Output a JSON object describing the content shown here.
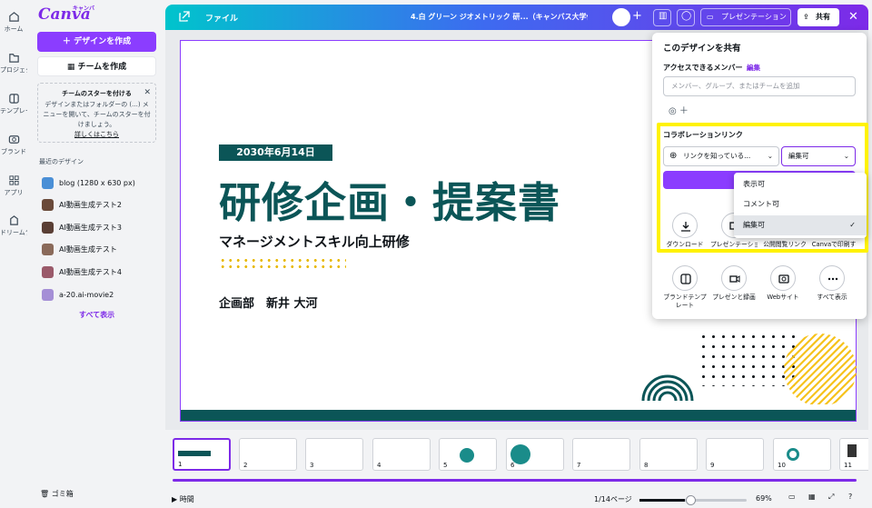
{
  "rail": {
    "items": [
      {
        "label": "ホーム",
        "icon": "home-icon"
      },
      {
        "label": "プロジェク...",
        "icon": "folder-icon"
      },
      {
        "label": "テンプレー...",
        "icon": "template-icon"
      },
      {
        "label": "ブランド",
        "icon": "brand-icon"
      },
      {
        "label": "アプリ",
        "icon": "apps-icon"
      },
      {
        "label": "ドリームラ...",
        "icon": "dream-lab-icon"
      }
    ]
  },
  "sidebar": {
    "logo": "Canva",
    "logo_sub": "キャンバ",
    "create_button": "デザインを作成",
    "team_button": "チームを作成",
    "promo": {
      "title": "チームのスターを付ける",
      "body": "デザインまたはフォルダーの (...) メニューを開いて、チームのスターを付けましょう。",
      "link": "詳しくはこちら"
    },
    "recent_heading": "最近のデザイン",
    "recent": [
      "blog (1280 x 630 px)",
      "AI動画生成テスト2",
      "AI動画生成テスト3",
      "AI動画生成テスト",
      "AI動画生成テスト4",
      "a-20.ai-movie2"
    ],
    "show_all": "すべて表示",
    "trash": "ゴミ箱"
  },
  "topbar": {
    "file": "ファイル",
    "title": "4.白 グリーン ジオメトリック 研...（キャンバス大学作）",
    "present": "プレゼンテーション",
    "share": "共有"
  },
  "slide": {
    "date": "2030年6月14日",
    "title": "研修企画・提案書",
    "subtitle": "マネージメントスキル向上研修",
    "author": "企画部　新井 大河"
  },
  "share_panel": {
    "title": "このデザインを共有",
    "access_label": "アクセスできるメンバー",
    "edit_link": "編集",
    "input_placeholder": "メンバー、グループ、またはチームを追加",
    "collab_label": "コラボレーションリンク",
    "link_select": "リンクを知っている...",
    "perm_select": "編集可",
    "actions": [
      "ダウンロード",
      "プレゼンテーション",
      "公開閲覧リンク",
      "Canvaで印刷す"
    ],
    "more_actions": [
      "ブランドテンプレート",
      "プレゼンと録画",
      "Webサイト",
      "すべて表示"
    ],
    "highlight_color": "#fff200"
  },
  "dropdown": {
    "options": [
      "表示可",
      "コメント可",
      "編集可"
    ],
    "selected": "編集可"
  },
  "filmstrip": {
    "pages": [
      "1",
      "2",
      "3",
      "4",
      "5",
      "6",
      "7",
      "8",
      "9",
      "10",
      "11"
    ]
  },
  "bottom": {
    "timer": "時間",
    "page": "1/14ページ",
    "zoom": "69%",
    "zoom_level": 0.69
  }
}
